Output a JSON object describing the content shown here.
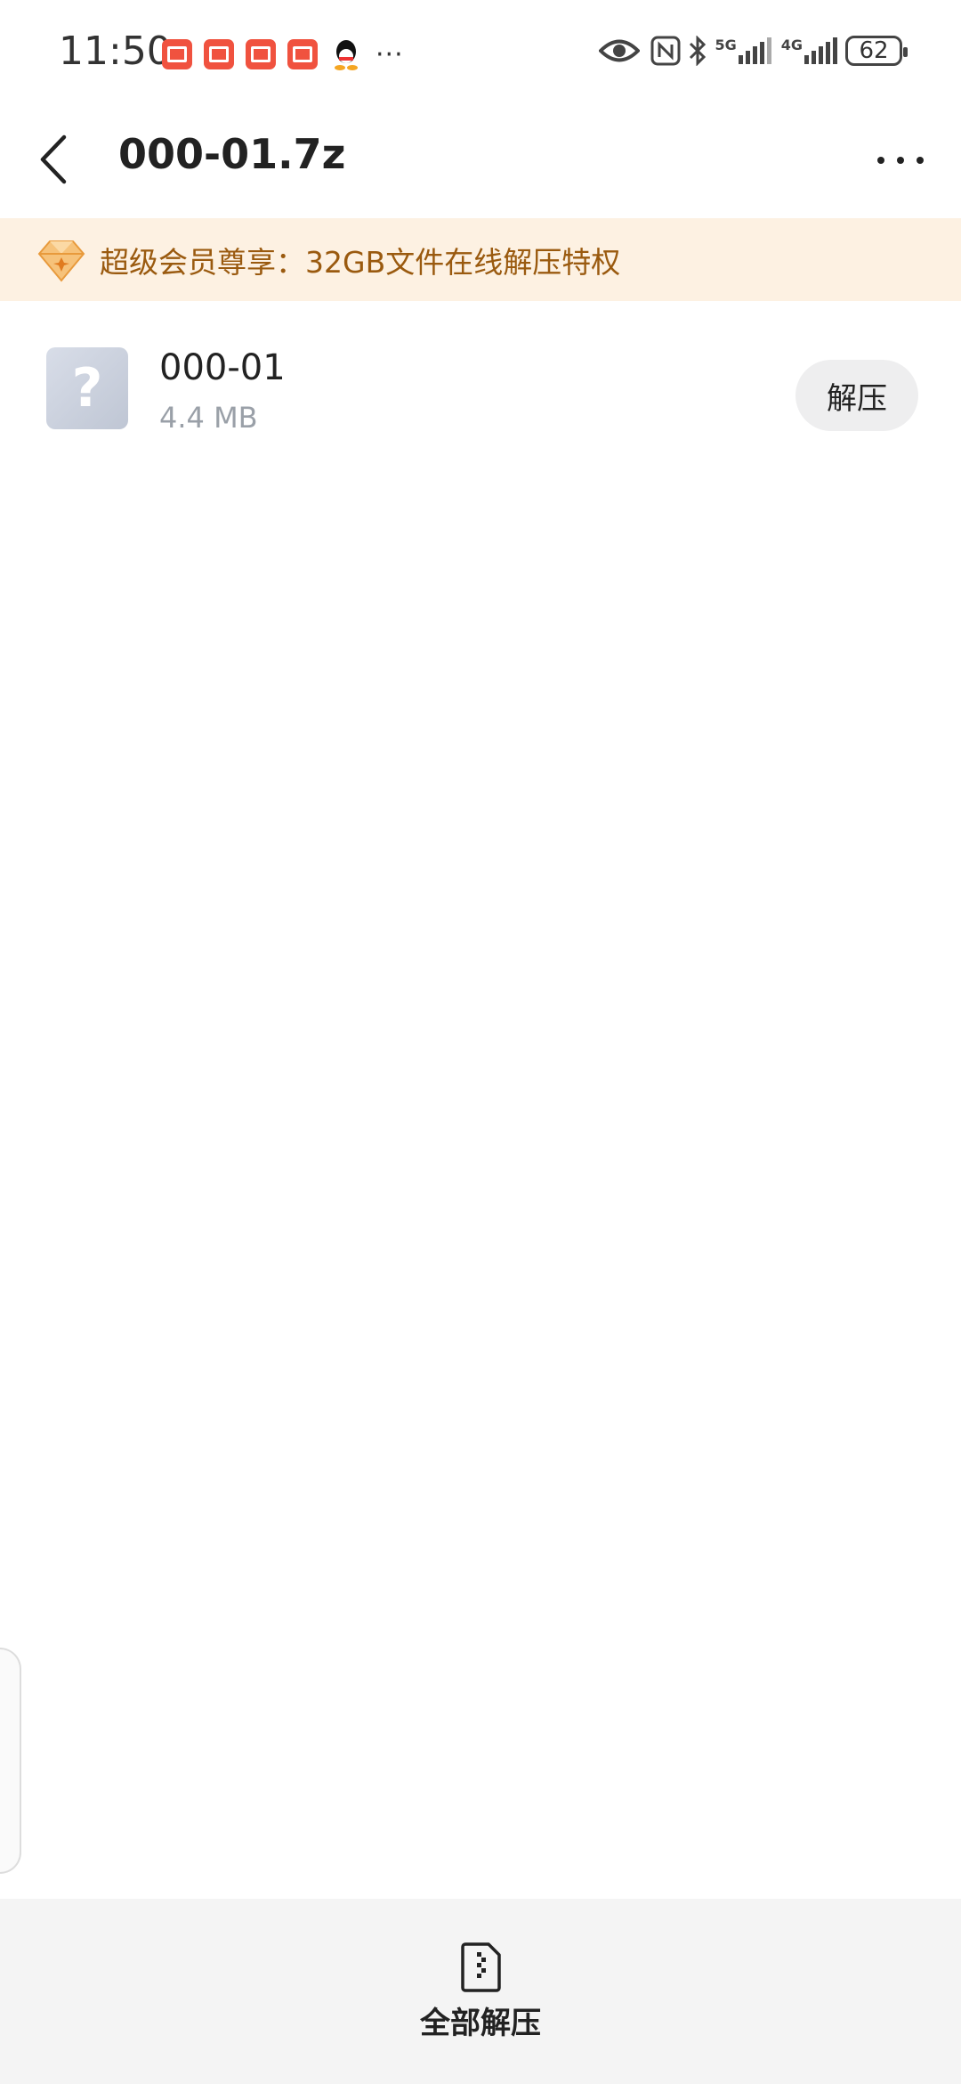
{
  "status_bar": {
    "time": "11:50",
    "notification_icons": [
      "app-icon",
      "app-icon",
      "huawei-store-icon",
      "book-icon",
      "qq-icon"
    ],
    "more": "···",
    "network_1": "5G",
    "network_2": "4G",
    "battery": "62"
  },
  "header": {
    "title": "000-01.7z"
  },
  "banner": {
    "text": "超级会员尊享：32GB文件在线解压特权"
  },
  "files": [
    {
      "name": "000-01",
      "size": "4.4 MB",
      "action": "解压"
    }
  ],
  "bottom_bar": {
    "extract_all_label": "全部解压"
  },
  "colors": {
    "banner_bg": "#fdf1e2",
    "banner_text": "#9a5a0f",
    "accent_orange": "#f0523f"
  }
}
